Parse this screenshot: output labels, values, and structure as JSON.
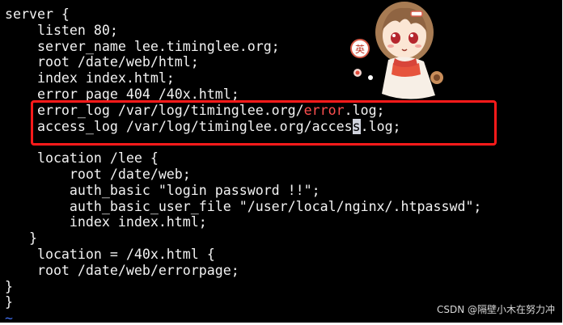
{
  "editor": {
    "lines": {
      "l1": "server {",
      "l2": "    listen 80;",
      "l3": "    server_name lee.timinglee.org;",
      "l4": "    root /date/web/html;",
      "l5": "    index index.html;",
      "l6": "    error_page 404 /40x.html;",
      "l7_pre": "    error_log /var/log/timinglee.org/",
      "l7_red": "error",
      "l7_post": ".log;",
      "l8_pre": "    access_log /var/log/timinglee.org/acces",
      "l8_cursor": "s",
      "l8_post": ".log;",
      "l9": "",
      "l10": "    location /lee {",
      "l11": "        root /date/web;",
      "l12": "        auth_basic \"login password !!\";",
      "l13": "        auth_basic_user_file \"/user/local/nginx/.htpasswd\";",
      "l14": "        index index.html;",
      "l15": "   }",
      "l16": "    location = /40x.html {",
      "l17": "    root /date/web/errorpage;",
      "l18": "}",
      "l19": "}",
      "l20": "~"
    },
    "colors": {
      "background": "#000000",
      "text": "#f2f2f2",
      "keyword_red": "#ff4f4f",
      "tilde": "#3f6be8",
      "highlight_box": "#ff1a1a"
    }
  },
  "sticker": {
    "badge_char": "英",
    "icon": "anime-girl-sticker"
  },
  "watermark": {
    "text": "CSDN @隔壁小木在努力冲"
  }
}
